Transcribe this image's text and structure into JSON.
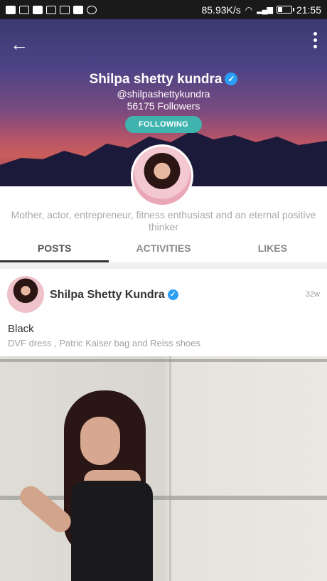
{
  "status_bar": {
    "speed": "85.93K/s",
    "time": "21:55"
  },
  "profile": {
    "name": "Shilpa shetty kundra",
    "handle": "@shilpashettykundra",
    "followers": "56175 Followers",
    "follow_button": "FOLLOWING",
    "bio": "Mother, actor, entrepreneur, fitness enthusiast and an eternal positive thinker"
  },
  "tabs": [
    {
      "label": "POSTS",
      "active": true
    },
    {
      "label": "ACTIVITIES",
      "active": false
    },
    {
      "label": "LIKES",
      "active": false
    }
  ],
  "post": {
    "author": "Shilpa Shetty Kundra",
    "time": "32w",
    "title": "Black",
    "description": "DVF dress , Patric Kaiser bag and Reiss shoes"
  },
  "colors": {
    "accent": "#3fb4ae",
    "verified": "#2a9df4"
  }
}
